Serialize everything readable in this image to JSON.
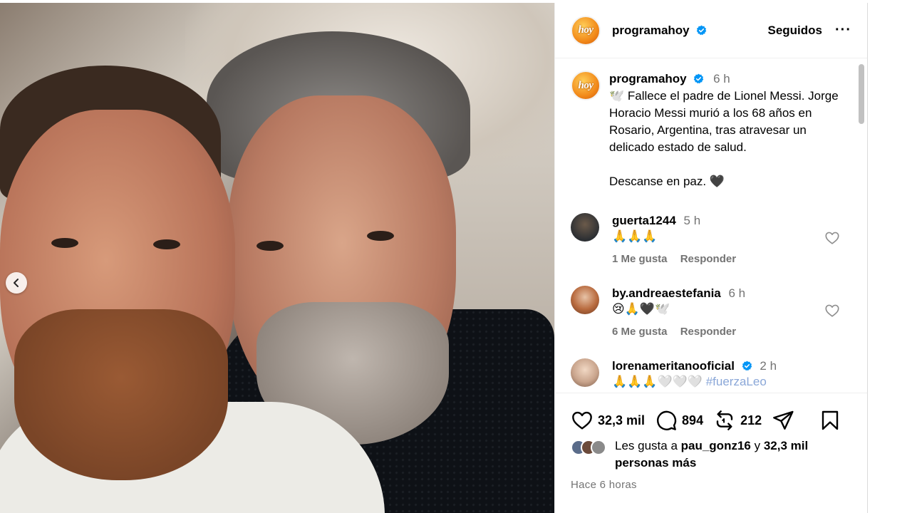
{
  "post": {
    "username": "programahoy",
    "avatar_text": "hoy",
    "follow_label": "Seguidos",
    "more_label": "···",
    "caption_time": "6 h",
    "caption_text": "🕊️ Fallece el padre de Lionel Messi. Jorge Horacio Messi murió a los 68 años en Rosario, Argentina, tras atravesar un delicado estado de salud.\n\nDescanse en paz. 🖤"
  },
  "comments": [
    {
      "user": "guerta1244",
      "time": "5 h",
      "text": "🙏🙏🙏",
      "likes": "1 Me gusta",
      "reply": "Responder",
      "avatar_color": "#2c2f33"
    },
    {
      "user": "by.andreaestefania",
      "time": "6 h",
      "text": "😢🙏🖤🕊️",
      "likes": "6 Me gusta",
      "reply": "Responder",
      "avatar_color": "#b86a3e"
    },
    {
      "user": "lorenameritanooficial",
      "time": "2 h",
      "text": "🙏🙏🙏🤍🤍🤍 #fuerzaLeo",
      "avatar_color": "#c9a48c"
    }
  ],
  "actions": {
    "likes_count": "32,3 mil",
    "comments_count": "894",
    "reposts_count": "212"
  },
  "liked_by": {
    "prefix": "Les gusta a ",
    "user": "pau_gonz16",
    "middle": " y ",
    "others": "32,3 mil personas más"
  },
  "timestamp": "Hace 6 horas",
  "colors": {
    "verified": "#0095f6",
    "secondary_text": "#737373",
    "accent_orange": "#f28a1a"
  }
}
